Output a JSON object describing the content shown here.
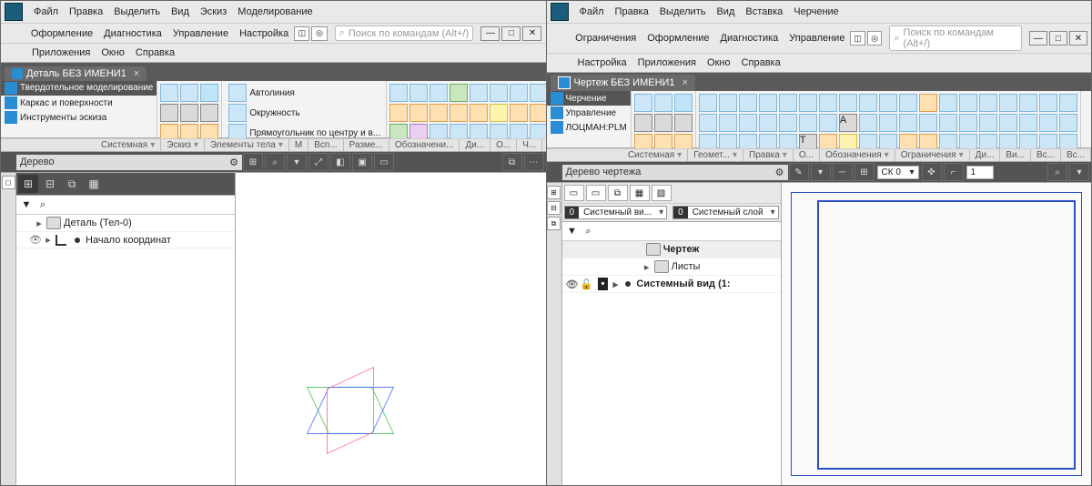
{
  "left": {
    "menu1": [
      "Файл",
      "Правка",
      "Выделить",
      "Вид",
      "Эскиз",
      "Моделирование"
    ],
    "menu2": [
      "Оформление",
      "Диагностика",
      "Управление",
      "Настройка"
    ],
    "menu3": [
      "Приложения",
      "Окно",
      "Справка"
    ],
    "search_ph": "Поиск по командам (Alt+/)",
    "tab": "Деталь БЕЗ ИМЕНИ1",
    "modes": [
      {
        "label": "Твердотельное моделирование",
        "dark": true
      },
      {
        "label": "Каркас и поверхности",
        "dark": false
      },
      {
        "label": "Инструменты эскиза",
        "dark": false
      }
    ],
    "sketch_cmds": [
      "Автолиния",
      "Окружность",
      "Прямоугольник по центру и в..."
    ],
    "groups": [
      "Системная",
      "Эскиз",
      "Элементы тела",
      "М",
      "Всп...",
      "Разме...",
      "Обозначени...",
      "Ди...",
      "О...",
      "Ч..."
    ],
    "panel_title": "Дерево",
    "tree": {
      "root": "Деталь (Тел-0)",
      "child": "Начало координат"
    }
  },
  "right": {
    "menu1": [
      "Файл",
      "Правка",
      "Выделить",
      "Вид",
      "Вставка",
      "Черчение"
    ],
    "menu2": [
      "Ограничения",
      "Оформление",
      "Диагностика",
      "Управление"
    ],
    "menu3": [
      "Настройка",
      "Приложения",
      "Окно",
      "Справка"
    ],
    "search_ph": "Поиск по командам (Alt+/)",
    "tab": "Чертеж БЕЗ ИМЕНИ1",
    "modes": [
      {
        "label": "Черчение",
        "dark": true
      },
      {
        "label": "Управление",
        "dark": false
      },
      {
        "label": "ЛОЦМАН:PLM",
        "dark": false
      }
    ],
    "groups": [
      "Системная",
      "Геомет...",
      "Правка",
      "О...",
      "Обозначения",
      "Ограничения",
      "Ди...",
      "Ви...",
      "Вс...",
      "Вс..."
    ],
    "panel_title": "Дерево чертежа",
    "layers": {
      "view": "Системный ви...",
      "layer": "Системный слой",
      "num": "0"
    },
    "tree": {
      "root": "Чертеж",
      "sheets": "Листы",
      "sysview": "Системный вид (1:"
    },
    "ck": "СК 0",
    "step": "1"
  }
}
